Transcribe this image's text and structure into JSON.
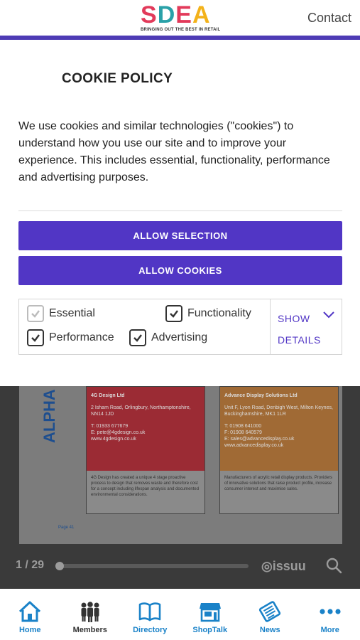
{
  "header": {
    "logo_letters": [
      "S",
      "D",
      "E",
      "A"
    ],
    "logo_tagline": "BRINGING OUT THE BEST IN RETAIL",
    "contact": "Contact"
  },
  "cookie": {
    "title": "COOKIE POLICY",
    "text": "We use cookies and similar technologies (\"cookies\") to understand how you use our site and to improve your experience. This includes essential, functionality, performance and advertising purposes.",
    "allow_selection": "ALLOW SELECTION",
    "allow_cookies": "ALLOW COOKIES",
    "options": {
      "essential": {
        "label": "Essential",
        "checked": true,
        "disabled": true
      },
      "functionality": {
        "label": "Functionality",
        "checked": true
      },
      "performance": {
        "label": "Performance",
        "checked": true
      },
      "advertising": {
        "label": "Advertising",
        "checked": true
      }
    },
    "show_details": "SHOW",
    "details": "DETAILS"
  },
  "viewer": {
    "side_label": "ALPHA",
    "card_left": {
      "name": "4G Design Ltd",
      "address": "2 Isham Road, Orlingbury, Northamptonshire, NN14 1JD",
      "phone": "T: 01933 677679",
      "email": "E: pete@4gdesign.co.uk",
      "web": "www.4gdesign.co.uk",
      "desc": "4G Design has created a unique 4 stage proactive process to design that removes waste and therefore cost for a concept including lifespan analysis and documented environmental considerations."
    },
    "card_right": {
      "name": "Advance Display Solutions Ltd",
      "address": "Unit F, Lyon Road, Denbigh West, Milton Keynes, Buckinghamshire, MK1 1LR",
      "phone": "T: 01908 641000",
      "fax": "F: 01908 640579",
      "email": "E: sales@advancedisplay.co.uk",
      "web": "www.advancedisplay.co.uk",
      "desc": "Manufacturers of acrylic retail display products. Providers of innovative solutions that raise product profile, increase consumer interest and maximise sales."
    },
    "page_label": "Page 41",
    "page_count": "1 / 29",
    "progress": 0.0,
    "brand": "issuu"
  },
  "tabs": [
    {
      "label": "Home",
      "icon": "home-icon"
    },
    {
      "label": "Members",
      "icon": "members-icon"
    },
    {
      "label": "Directory",
      "icon": "book-icon"
    },
    {
      "label": "ShopTalk",
      "icon": "shop-icon"
    },
    {
      "label": "News",
      "icon": "news-icon"
    },
    {
      "label": "More",
      "icon": "more-icon"
    }
  ],
  "colors": {
    "brand_purple": "#5136c5",
    "tab_blue": "#1a82c8"
  }
}
